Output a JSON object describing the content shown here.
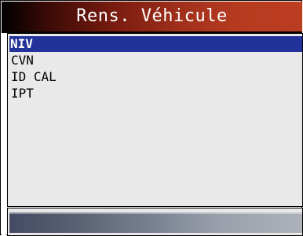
{
  "screen": {
    "title": "Rens. Véhicule"
  },
  "menu": {
    "items": [
      {
        "label": "NIV",
        "selected": true
      },
      {
        "label": "CVN",
        "selected": false
      },
      {
        "label": "ID CAL",
        "selected": false
      },
      {
        "label": "IPT",
        "selected": false
      }
    ]
  },
  "colors": {
    "title_gradient_start": "#000000",
    "title_gradient_end": "#bb3d22",
    "selection": "#23329a",
    "list_background": "#e9e9e9"
  }
}
